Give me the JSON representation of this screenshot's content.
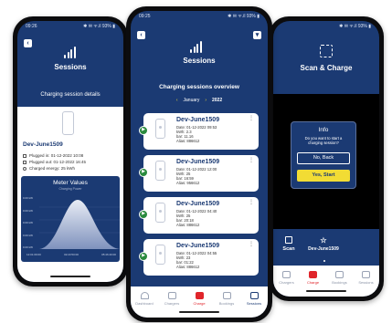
{
  "left": {
    "status_time": "09:26",
    "status_right": "✱ ✉ ᯤ.il 93% ▮",
    "title": "Sessions",
    "subtitle": "Charging session details",
    "device": "Dev-June1509",
    "plugged_in": "Plugged in: 01-12-2022 10:08",
    "plugged_out": "Plugged out: 01-12-2022 16:45",
    "charged_energy": "Charged energy: 25 kWh",
    "meter_title": "Meter Values",
    "meter_subtitle": "Charging Power",
    "y_labels": [
      "0.00 kW",
      "0.00 kW",
      "0.00 kW",
      "0.00 kW",
      "0.00 kW"
    ],
    "x_labels": [
      "12:01:09:00",
      "02:23:50:00",
      "05:46:40:00"
    ]
  },
  "middle": {
    "status_time": "09:25",
    "status_right": "✱ ✉ ᯤ.il 93% ▮",
    "title": "Sessions",
    "overview_title": "Charging sessions overview",
    "month": "January",
    "year": "2022",
    "cards": [
      {
        "device": "Dev-June1509",
        "date": "Date: 01-12-2022 09:53",
        "kwh": "kWh: 2.3",
        "bar": "bar: 11.16",
        "alias": "Alias: 886612"
      },
      {
        "device": "Dev-June1509",
        "date": "Date: 01-12-2022 12:00",
        "kwh": "kWh: 25",
        "bar": "bar: 16:59",
        "alias": "Alias: 956612"
      },
      {
        "device": "Dev-June1509",
        "date": "Date: 01-12-2022 04:40",
        "kwh": "kWh: 25",
        "bar": "bar: 20:18",
        "alias": "Alias: 886612"
      },
      {
        "device": "Dev-June1509",
        "date": "Date: 01-12-2022 04:55",
        "kwh": "kWh: 23",
        "bar": "bar: 01:22",
        "alias": "Alias: 886612"
      }
    ],
    "nav": [
      "Dashboard",
      "Chargers",
      "Charge",
      "Bookings",
      "Sessions"
    ]
  },
  "right": {
    "status_right": "✱ ✉ ᯤ.il 93% ▮",
    "title": "Scan & Charge",
    "dialog_title": "Info",
    "dialog_text": "Do you want to start a charging session?",
    "no_button": "No, Back",
    "yes_button": "Yes, Start",
    "scan_label": "Scan",
    "device_label": "Dev-June1509",
    "nav": [
      "Chargers",
      "Charge",
      "Bookings",
      "Sessions"
    ]
  },
  "colors": {
    "navy": "#1b3a73",
    "accent_red": "#e0252b",
    "yellow": "#f2dc34",
    "green": "#2a8a3e"
  }
}
